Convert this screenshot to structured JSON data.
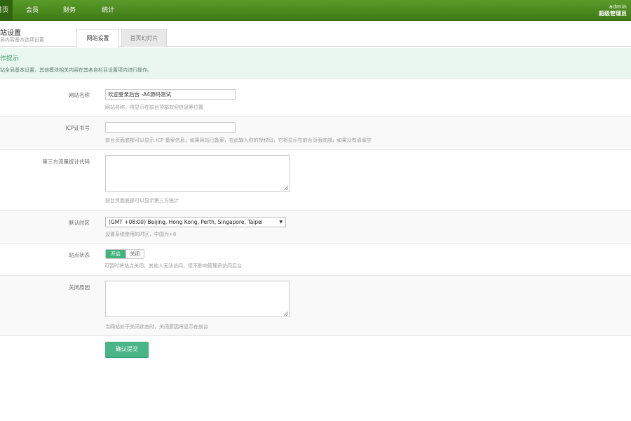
{
  "nav": {
    "items": [
      "首页",
      "会员",
      "财务",
      "统计"
    ]
  },
  "user": {
    "name": "admin",
    "role": "超级管理员"
  },
  "header": {
    "title": "网站设置",
    "subtitle": "网站全局内容基本选项设置"
  },
  "tabs": [
    {
      "label": "网站设置"
    },
    {
      "label": "首页幻灯片"
    }
  ],
  "tips": {
    "title": "操作提示",
    "text": "网站全局基本设置，其他模块相关内容在其各自栏目设置项内进行操作。"
  },
  "form": {
    "site_name": {
      "label": "网站名称",
      "value": "欢迎登录后台 -A4源码测试",
      "hint": "网站名称，将显示在前台顶部欢迎信息等位置"
    },
    "icp": {
      "label": "ICP证书号",
      "value": "",
      "hint": "前台页面底部可以显示 ICP 备案信息，如果网站已备案，在此输入你的授权码，它将显示在前台页面底部，如果没有请留空"
    },
    "stats_code": {
      "label": "第三方流量统计代码",
      "hint": "前台页面底部可以显示第三方统计"
    },
    "timezone": {
      "label": "默认时区",
      "selected": "(GMT +08:00) Beijing, Hong Kong, Perth, Singapore, Taipei",
      "hint": "设置系统使用的时区，中国为+8"
    },
    "site_status": {
      "label": "站点状态",
      "on_label": "开启",
      "off_label": "关闭",
      "hint": "可暂时将站点关闭，其他人无法访问，但不影响管理员访问后台"
    },
    "close_reason": {
      "label": "关闭原因",
      "hint": "当网站处于关闭状态时，关闭原因将显示在前台"
    },
    "submit_label": "确认提交"
  },
  "colors": {
    "topbar": "#4a8a1f",
    "accent": "#48b487",
    "tips_bg": "#eaf6f0"
  }
}
